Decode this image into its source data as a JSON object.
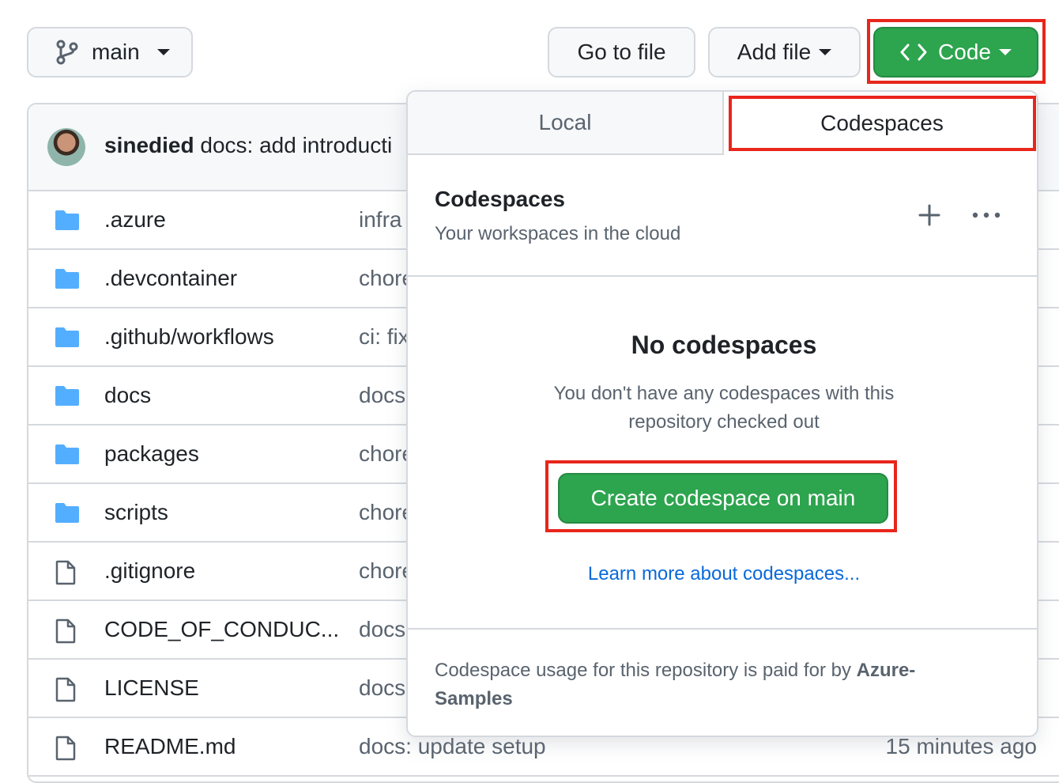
{
  "toolbar": {
    "branch_label": "main",
    "goto_file_label": "Go to file",
    "add_file_label": "Add file",
    "code_label": "Code"
  },
  "commit": {
    "author": "sinedied",
    "message": "docs: add introducti"
  },
  "files": [
    {
      "name": ".azure",
      "message": "infra",
      "type": "folder"
    },
    {
      "name": ".devcontainer",
      "message": "chore",
      "type": "folder"
    },
    {
      "name": ".github/workflows",
      "message": "ci: fix",
      "type": "folder"
    },
    {
      "name": "docs",
      "message": "docs",
      "type": "folder"
    },
    {
      "name": "packages",
      "message": "chore",
      "type": "folder"
    },
    {
      "name": "scripts",
      "message": "chore",
      "type": "folder"
    },
    {
      "name": ".gitignore",
      "message": "chore",
      "type": "file"
    },
    {
      "name": "CODE_OF_CONDUC...",
      "message": "docs",
      "type": "file"
    },
    {
      "name": "LICENSE",
      "message": "docs",
      "type": "file"
    },
    {
      "name": "README.md",
      "message": "docs: update setup",
      "type": "file",
      "time": "15 minutes ago"
    }
  ],
  "dropdown": {
    "tabs": {
      "local": "Local",
      "codespaces": "Codespaces"
    },
    "header_title": "Codespaces",
    "header_subtitle": "Your workspaces in the cloud",
    "empty_title": "No codespaces",
    "empty_text_line1": "You don't have any codespaces with this",
    "empty_text_line2": "repository checked out",
    "create_button": "Create codespace on main",
    "learn_more": "Learn more about codespaces...",
    "footer_text": "Codespace usage for this repository is paid for by",
    "footer_owner_line1": "Azure-",
    "footer_owner_line2": "Samples"
  },
  "colors": {
    "primary_green": "#2da44e",
    "link_blue": "#0969da",
    "highlight_red": "#e8261b",
    "folder_blue": "#54aeff"
  },
  "icons": {
    "branch": "git-branch-icon",
    "code": "code-brackets-icon",
    "folder": "folder-icon",
    "file": "file-icon",
    "plus": "plus-icon",
    "more": "kebab-horizontal-icon"
  }
}
